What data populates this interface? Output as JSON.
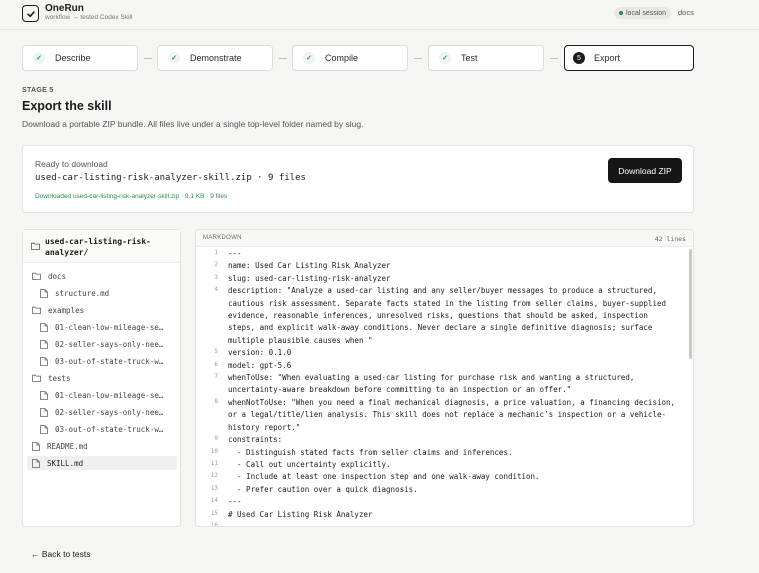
{
  "header": {
    "app_name": "OneRun",
    "breadcrumb": "workflow → tested Codex Skill",
    "session": "local session",
    "docs": "docs"
  },
  "stepper": [
    {
      "label": "Describe",
      "state": "done"
    },
    {
      "label": "Demonstrate",
      "state": "done"
    },
    {
      "label": "Compile",
      "state": "done"
    },
    {
      "label": "Test",
      "state": "done"
    },
    {
      "label": "Export",
      "state": "active",
      "number": "5"
    }
  ],
  "stage": {
    "label": "STAGE 5",
    "title": "Export the skill",
    "subtitle": "Download a portable ZIP bundle. All files live under a single top-level folder named by slug."
  },
  "download": {
    "ready": "Ready to download",
    "filename": "used-car-listing-risk-analyzer-skill.zip · 9 files",
    "status": "Downloaded used-car-listing-risk-analyzer-skill.zip · 9.1 KB · 9 files",
    "button": "Download ZIP"
  },
  "tree": {
    "root": "used-car-listing-risk-analyzer/",
    "items": [
      {
        "label": "docs",
        "type": "folder",
        "depth": 0
      },
      {
        "label": "structure.md",
        "type": "file",
        "depth": 1
      },
      {
        "label": "examples",
        "type": "folder",
        "depth": 0
      },
      {
        "label": "01-clean-low-mileage-se…",
        "type": "file",
        "depth": 1
      },
      {
        "label": "02-seller-says-only-nee…",
        "type": "file",
        "depth": 1
      },
      {
        "label": "03-out-of-state-truck-w…",
        "type": "file",
        "depth": 1
      },
      {
        "label": "tests",
        "type": "folder",
        "depth": 0
      },
      {
        "label": "01-clean-low-mileage-se…",
        "type": "file",
        "depth": 1
      },
      {
        "label": "02-seller-says-only-nee…",
        "type": "file",
        "depth": 1
      },
      {
        "label": "03-out-of-state-truck-w…",
        "type": "file",
        "depth": 1
      },
      {
        "label": "README.md",
        "type": "file",
        "depth": 0
      },
      {
        "label": "SKILL.md",
        "type": "file",
        "depth": 0,
        "selected": true
      }
    ]
  },
  "editor": {
    "language": "MARKDOWN",
    "line_count": "42 lines",
    "lines": [
      {
        "n": "1",
        "text": [
          "---"
        ]
      },
      {
        "n": "2",
        "text": [
          "name: Used Car Listing Risk Analyzer"
        ]
      },
      {
        "n": "3",
        "text": [
          "slug: used-car-listing-risk-analyzer"
        ]
      },
      {
        "n": "4",
        "text": [
          "description: \"Analyze a used-car listing and any seller/buyer messages to produce a structured,",
          "cautious risk assessment. Separate facts stated in the listing from seller claims, buyer-supplied",
          "evidence, reasonable inferences, unresolved risks, questions that should be asked, inspection",
          "steps, and explicit walk-away conditions. Never declare a single definitive diagnosis; surface",
          "multiple plausible causes when \""
        ]
      },
      {
        "n": "5",
        "text": [
          "version: 0.1.0"
        ]
      },
      {
        "n": "6",
        "text": [
          "model: gpt-5.6"
        ]
      },
      {
        "n": "7",
        "text": [
          "whenToUse: \"When evaluating a used-car listing for purchase risk and wanting a structured,",
          "uncertainty-aware breakdown before committing to an inspection or an offer.\""
        ]
      },
      {
        "n": "8",
        "text": [
          "whenNotToUse: \"When you need a final mechanical diagnosis, a price valuation, a financing decision,",
          "or a legal/title/lien analysis. This skill does not replace a mechanic's inspection or a vehicle-",
          "history report.\""
        ]
      },
      {
        "n": "9",
        "text": [
          "constraints:"
        ]
      },
      {
        "n": "10",
        "text": [
          "  - Distinguish stated facts from seller claims and inferences."
        ]
      },
      {
        "n": "11",
        "text": [
          "  - Call out uncertainty explicitly."
        ]
      },
      {
        "n": "12",
        "text": [
          "  - Include at least one inspection step and one walk-away condition."
        ]
      },
      {
        "n": "13",
        "text": [
          "  - Prefer caution over a quick diagnosis."
        ]
      },
      {
        "n": "14",
        "text": [
          "---"
        ]
      },
      {
        "n": "15",
        "text": [
          "# Used Car Listing Risk Analyzer"
        ]
      },
      {
        "n": "16",
        "text": [
          ""
        ]
      }
    ]
  },
  "back_link": "← Back to tests"
}
